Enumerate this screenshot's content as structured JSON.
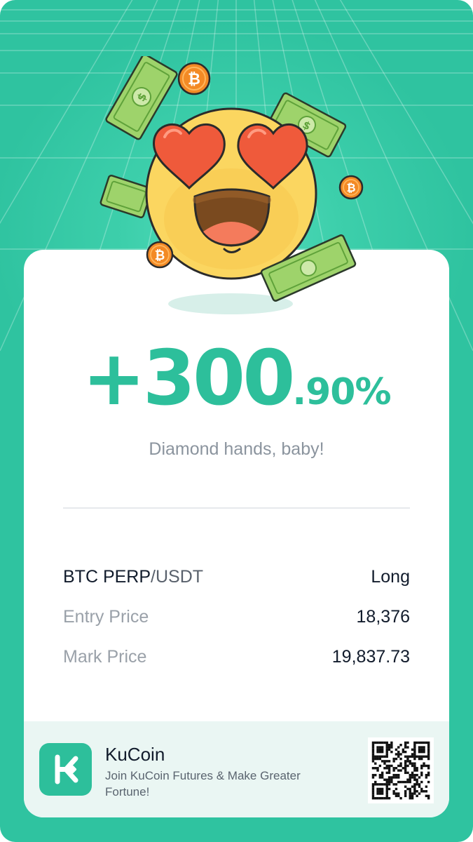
{
  "pnl": {
    "integer_part": "+300",
    "fraction_part": ".90%"
  },
  "slogan": "Diamond hands, baby!",
  "position": {
    "pair_base": "BTC PERP",
    "pair_quote": "/USDT",
    "side": "Long",
    "entry_label": "Entry Price",
    "entry_value": "18,376",
    "mark_label": "Mark Price",
    "mark_value": "19,837.73"
  },
  "footer": {
    "brand": "KuCoin",
    "tagline": "Join KuCoin Futures & Make Greater Fortune!"
  },
  "icons": {
    "illustration": "heart-eyes-emoji-with-money-icon",
    "coin": "bitcoin-coin-icon",
    "logo": "kucoin-logo-icon",
    "qr": "qr-code-icon"
  },
  "colors": {
    "background": "#2fc3a0",
    "accent": "#2dbf9b",
    "text_primary": "#121c2c",
    "text_muted": "#9aa1a9",
    "footer_bg": "#eaf6f3"
  }
}
